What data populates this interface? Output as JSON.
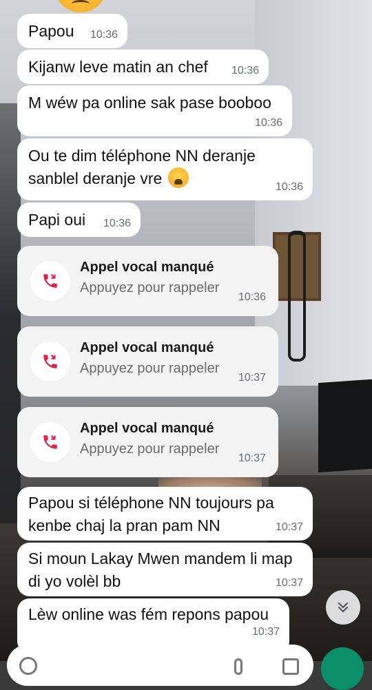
{
  "messages": [
    {
      "text": "Papou",
      "time": "10:36"
    },
    {
      "text": "Kijanw leve matin an chef",
      "time": "10:36"
    },
    {
      "text": "M wéw pa online sak pase booboo",
      "time": "10:36"
    },
    {
      "text_line1": "Ou te dim téléphone NN deranje",
      "text_line2": "sanblel deranje vre",
      "emoji": "weary-face-emoji",
      "time": "10:36"
    },
    {
      "text": "Papi oui",
      "time": "10:36"
    },
    {
      "text_line1": "Papou si téléphone NN toujours pa",
      "text_line2": "kenbe chaj la pran pam NN",
      "time": "10:37"
    },
    {
      "text_line1": "Si moun Lakay Mwen mandem li map",
      "text_line2": "di yo volèl bb",
      "time": "10:37"
    },
    {
      "text": "Lèw online was fém repons papou",
      "time": "10:37"
    }
  ],
  "calls": [
    {
      "title": "Appel vocal manqué",
      "subtitle": "Appuyez pour rappeler",
      "time": "10:36",
      "icon": "missed-call-icon"
    },
    {
      "title": "Appel vocal manqué",
      "subtitle": "Appuyez pour rappeler",
      "time": "10:37",
      "icon": "missed-call-icon"
    },
    {
      "title": "Appel vocal manqué",
      "subtitle": "Appuyez pour rappeler",
      "time": "10:37",
      "icon": "missed-call-icon"
    }
  ],
  "icons": {
    "scroll_down": "double-chevron-down-icon",
    "top_emoji": "frowning-face-emoji"
  },
  "colors": {
    "bubble": "#ffffff",
    "call_card": "#f3f3f3",
    "missed_call_red": "#e0224a",
    "timestamp": "#666a70",
    "send_button": "#0b8f6a"
  }
}
